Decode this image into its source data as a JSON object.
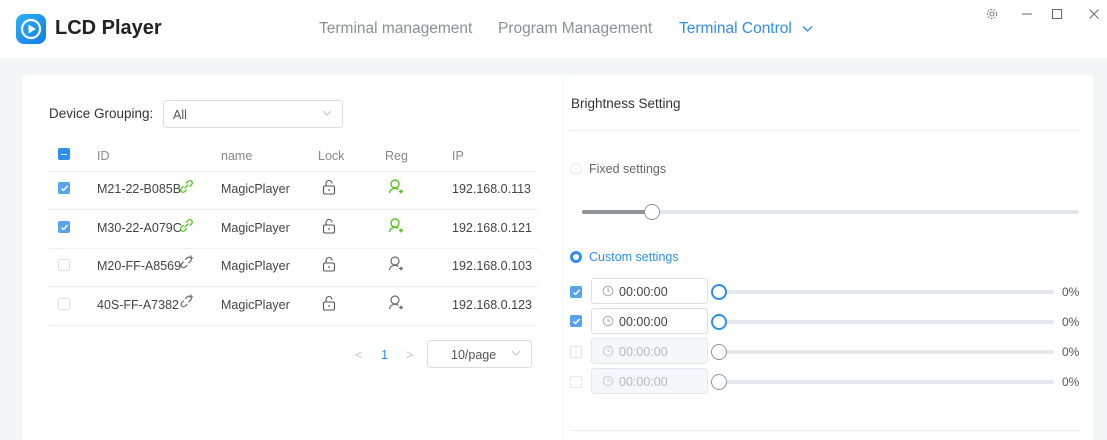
{
  "app": {
    "title": "LCD Player"
  },
  "nav": {
    "items": [
      {
        "label": "Terminal management"
      },
      {
        "label": "Program Management"
      },
      {
        "label": "Terminal Control"
      }
    ]
  },
  "window_controls": [
    "settings-icon",
    "minimize-icon",
    "maximize-icon",
    "close-icon"
  ],
  "device_panel": {
    "grouping_label": "Device Grouping:",
    "grouping_value": "All",
    "columns": {
      "id": "ID",
      "name": "name",
      "lock": "Lock",
      "reg": "Reg",
      "ip": "IP"
    },
    "rows": [
      {
        "id": "M21-22-B085B",
        "name": "MagicPlayer",
        "ip": "192.168.0.113",
        "checked": true,
        "linked": true,
        "registered": true
      },
      {
        "id": "M30-22-A079C",
        "name": "MagicPlayer",
        "ip": "192.168.0.121",
        "checked": true,
        "linked": true,
        "registered": true
      },
      {
        "id": "M20-FF-A8569",
        "name": "MagicPlayer",
        "ip": "192.168.0.103",
        "checked": false,
        "linked": false,
        "registered": false
      },
      {
        "id": "40S-FF-A7382",
        "name": "MagicPlayer",
        "ip": "192.168.0.123",
        "checked": false,
        "linked": false,
        "registered": false
      }
    ],
    "pager": {
      "prev": "<",
      "page": "1",
      "next": ">",
      "page_size": "10/page"
    }
  },
  "brightness": {
    "title": "Brightness Setting",
    "fixed_label": "Fixed settings",
    "fixed_selected": false,
    "fixed_level": 0.14,
    "custom_label": "Custom settings",
    "custom_selected": true,
    "schedules": [
      {
        "time": "00:00:00",
        "percent": "0%",
        "enabled": true
      },
      {
        "time": "00:00:00",
        "percent": "0%",
        "enabled": true
      },
      {
        "time": "00:00:00",
        "percent": "0%",
        "enabled": false
      },
      {
        "time": "00:00:00",
        "percent": "0%",
        "enabled": false
      }
    ]
  },
  "colors": {
    "accent": "#2e8df0",
    "link_green": "#52c41a",
    "text": "#333333",
    "muted": "#888888"
  }
}
